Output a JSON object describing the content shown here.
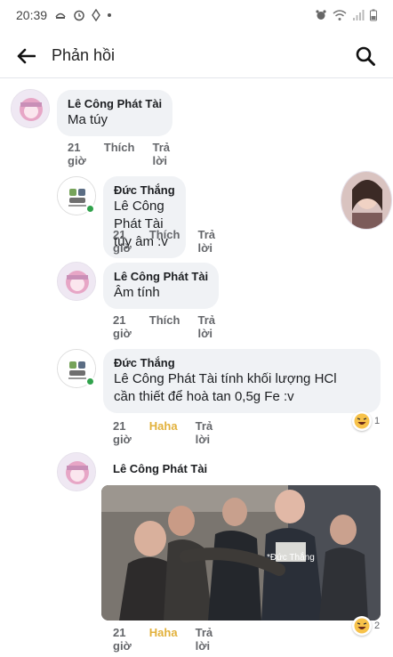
{
  "status_bar": {
    "time": "20:39"
  },
  "header": {
    "title": "Phản hồi"
  },
  "comments": [
    {
      "author": "Lê Công Phát Tài",
      "text": "Ma túy",
      "time": "21 giờ",
      "like": "Thích",
      "reply": "Trả lời"
    },
    {
      "author": "Đức Thắng",
      "text": "Lê Công Phát Tài túy âm :v",
      "time": "21 giờ",
      "like": "Thích",
      "reply": "Trả lời"
    },
    {
      "author": "Lê Công Phát Tài",
      "text": "Âm tính",
      "time": "21 giờ",
      "like": "Thích",
      "reply": "Trả lời"
    },
    {
      "author": "Đức Thắng",
      "text_line1": "Lê Công Phát Tài tính khối lượng HCl",
      "text_line2": "cần thiết để hoà tan 0,5g Fe :v",
      "time": "21 giờ",
      "like": "Haha",
      "reply": "Trả lời",
      "reaction_count": "1"
    },
    {
      "author": "Lê Công Phát Tài",
      "photo_caption": "*Đức Thắng",
      "time": "21 giờ",
      "like": "Haha",
      "reply": "Trả lời",
      "reaction_count": "2"
    }
  ],
  "colors": {
    "online": "#31a24c",
    "haha": "#e2b13c",
    "bubble": "#f0f2f5"
  }
}
